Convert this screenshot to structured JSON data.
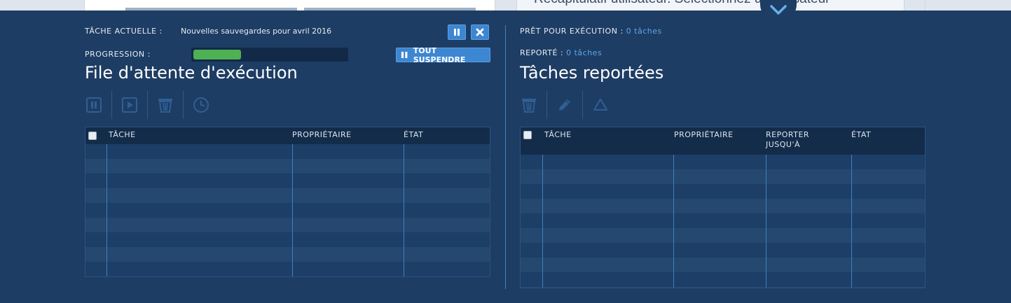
{
  "background": {
    "text": "Récapitulatif utilisateur. Sélectionnez un utilisateur"
  },
  "left": {
    "current_task_label": "TÂCHE ACTUELLE :",
    "current_task_value": "Nouvelles sauvegardes pour avril 2016",
    "progress_label": "PROGRESSION :",
    "progress_value": 0.31,
    "suspend_all_label": "TOUT SUSPENDRE",
    "title": "File d'attente d'exécution",
    "toolbar": [
      "pause-icon",
      "play-icon",
      "trash-icon",
      "clock-icon"
    ],
    "columns": [
      "TÂCHE",
      "PROPRIÉTAIRE",
      "ÉTAT"
    ]
  },
  "right": {
    "ready_label": "PRÊT POUR EXÉCUTION :",
    "ready_value": "0 tâches",
    "postponed_label": "REPORTÉ :",
    "postponed_value": "0 tâches",
    "title": "Tâches reportées",
    "toolbar": [
      "trash-icon",
      "pencil-icon",
      "triangle-icon"
    ],
    "columns": [
      "TÂCHE",
      "PROPRIÉTAIRE",
      "REPORTER JUSQU'À",
      "ÉTAT"
    ]
  },
  "colors": {
    "panel_bg": "#1e3d64",
    "accent": "#3d86d2",
    "link": "#5ea6e8",
    "progress": "#4eb154"
  }
}
